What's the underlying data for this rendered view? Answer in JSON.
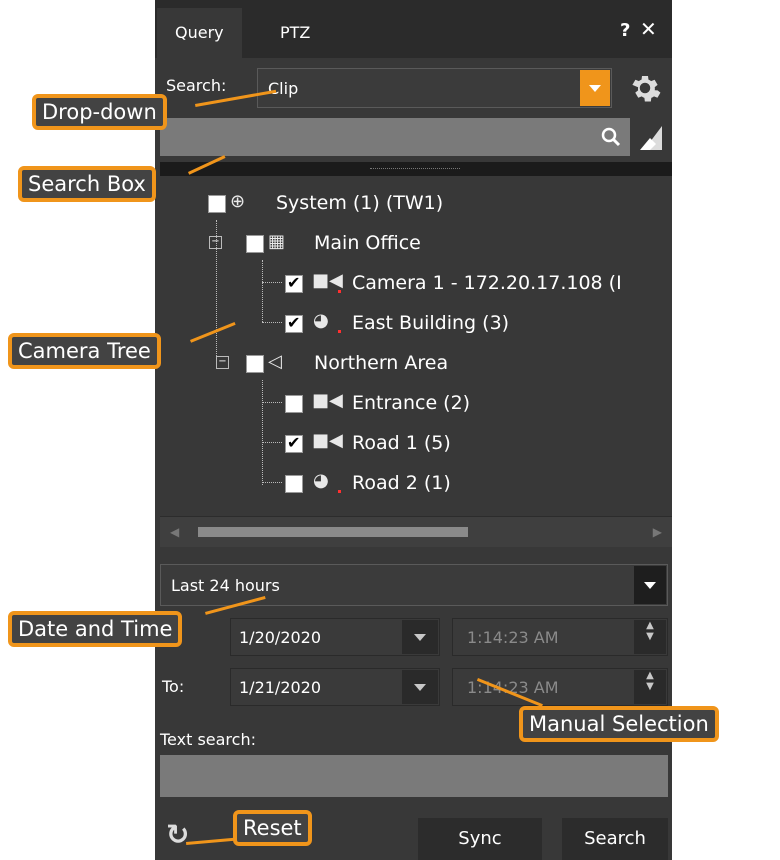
{
  "tabs": [
    {
      "label": "Query",
      "active": true
    },
    {
      "label": "PTZ",
      "active": false
    }
  ],
  "window_controls": {
    "help": "?",
    "close": "✕"
  },
  "search": {
    "label": "Search:",
    "value": "Clip",
    "icon": "gear-icon"
  },
  "searchbox": {
    "placeholder": "",
    "icons": [
      "search-icon",
      "eraser-icon"
    ]
  },
  "tree": {
    "root": "System (1) (TW1)",
    "groups": [
      {
        "label": "Main Office",
        "children": [
          {
            "label": "Camera 1 - 172.20.17.108 (I",
            "checked": true,
            "icon": "camera-icon"
          },
          {
            "label": "East Building (3)",
            "checked": true,
            "icon": "ptz-camera-icon"
          }
        ]
      },
      {
        "label": "Northern Area",
        "children": [
          {
            "label": "Entrance (2)",
            "checked": false,
            "icon": "camera-icon"
          },
          {
            "label": "Road 1 (5)",
            "checked": true,
            "icon": "camera-icon"
          },
          {
            "label": "Road 2 (1)",
            "checked": false,
            "icon": "ptz-camera-icon"
          }
        ]
      }
    ]
  },
  "range": {
    "value": "Last 24 hours"
  },
  "from": {
    "date": "1/20/2020",
    "time": "1:14:23 AM"
  },
  "to": {
    "label": "To:",
    "date": "1/21/2020",
    "time": "1:14:23 AM"
  },
  "text_search": {
    "label": "Text search:",
    "value": ""
  },
  "buttons": {
    "sync": "Sync",
    "search": "Search"
  },
  "callouts": {
    "dropdown": "Drop-down",
    "search_box": "Search Box",
    "camera_tree": "Camera Tree",
    "date_time": "Date and Time",
    "manual": "Manual Selection",
    "reset": "Reset"
  },
  "colors": {
    "accent": "#f0951b",
    "panel": "#383838",
    "tabbar": "#2b2b2b"
  }
}
